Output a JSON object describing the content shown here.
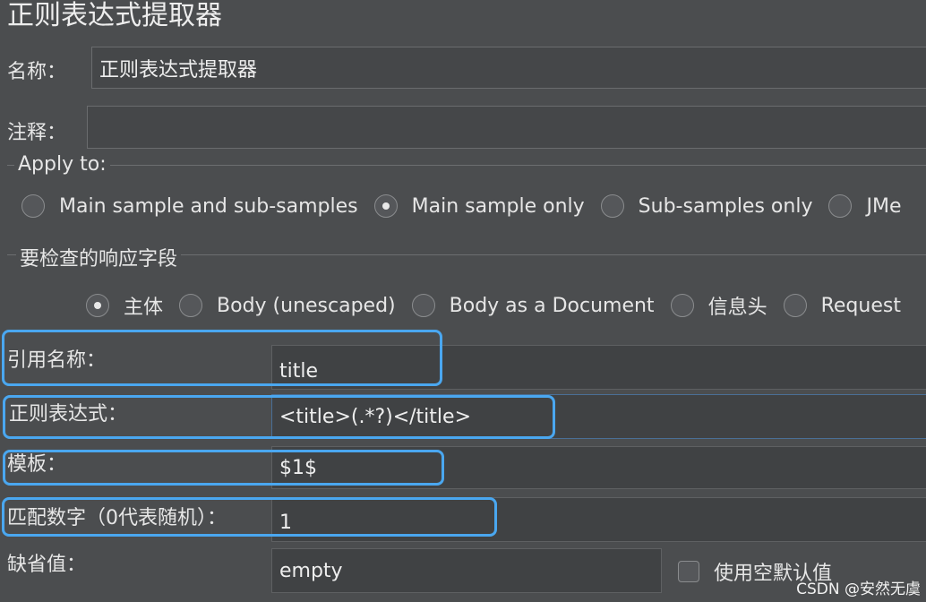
{
  "title": "正则表达式提取器",
  "name_field": {
    "label": "名称：",
    "value": "正则表达式提取器"
  },
  "comment_field": {
    "label": "注释：",
    "value": ""
  },
  "apply_to": {
    "label": "Apply to:",
    "options": [
      {
        "label": "Main sample and sub-samples",
        "selected": false
      },
      {
        "label": "Main sample only",
        "selected": true
      },
      {
        "label": "Sub-samples only",
        "selected": false
      },
      {
        "label": "JMe",
        "selected": false
      }
    ]
  },
  "response_field": {
    "label": "要检查的响应字段",
    "options": [
      {
        "label": "主体",
        "selected": true
      },
      {
        "label": "Body (unescaped)",
        "selected": false
      },
      {
        "label": "Body as a Document",
        "selected": false
      },
      {
        "label": "信息头",
        "selected": false
      },
      {
        "label": "Request",
        "selected": false
      }
    ]
  },
  "ref_name": {
    "label": "引用名称：",
    "value": "title"
  },
  "regex": {
    "label": "正则表达式：",
    "value": "<title>(.*?)</title>"
  },
  "template": {
    "label": "模板：",
    "value": "$1$"
  },
  "match_no": {
    "label": "匹配数字（0代表随机）：",
    "value": "1"
  },
  "default_value": {
    "label": "缺省值：",
    "value": "empty"
  },
  "use_empty_default": {
    "label": "使用空默认值",
    "checked": false
  },
  "watermark": "CSDN @安然无虞",
  "colors": {
    "highlight": "#4aa7f0",
    "background": "#4b4d4f"
  }
}
